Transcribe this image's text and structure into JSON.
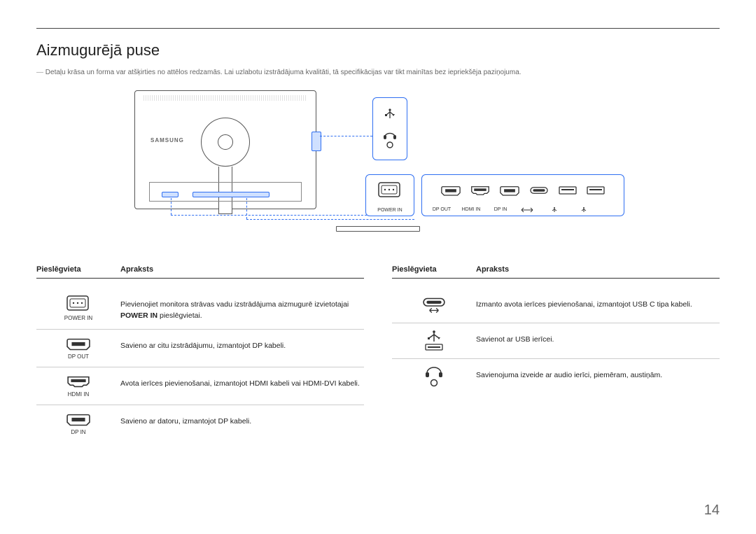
{
  "title": "Aizmugurējā puse",
  "note": "Detaļu krāsa un forma var atšķirties no attēlos redzamās. Lai uzlabotu izstrādājuma kvalitāti, tā specifikācijas var tikt mainītas bez iepriekšēja paziņojuma.",
  "brand": "SAMSUNG",
  "callout_power_label": "POWER IN",
  "callout_port_labels": [
    "DP OUT",
    "HDMI IN",
    "DP IN",
    "⬌",
    "⬌",
    "⬌"
  ],
  "thead": {
    "c1": "Pieslēgvieta",
    "c2": "Apraksts"
  },
  "left_rows": [
    {
      "icon": "power",
      "label": "POWER IN",
      "desc_pre": "Pievienojiet monitora strāvas vadu izstrādājuma aizmugurē izvietotajai ",
      "desc_bold": "POWER IN",
      "desc_post": " pieslēgvietai."
    },
    {
      "icon": "dp",
      "label": "DP OUT",
      "desc": "Savieno ar citu izstrādājumu, izmantojot DP kabeli."
    },
    {
      "icon": "hdmi",
      "label": "HDMI IN",
      "desc": "Avota ierīces pievienošanai, izmantojot HDMI kabeli vai HDMI-DVI kabeli."
    },
    {
      "icon": "dp",
      "label": "DP IN",
      "desc": "Savieno ar datoru, izmantojot DP kabeli."
    }
  ],
  "right_rows": [
    {
      "icon": "usbc",
      "label": "",
      "desc": "Izmanto avota ierīces pievienošanai, izmantojot USB C tipa kabeli."
    },
    {
      "icon": "usba",
      "label": "",
      "desc": "Savienot ar USB ierīcei."
    },
    {
      "icon": "audio",
      "label": "",
      "desc": "Savienojuma izveide ar audio ierīci, piemēram, austiņām."
    }
  ],
  "page_number": "14"
}
